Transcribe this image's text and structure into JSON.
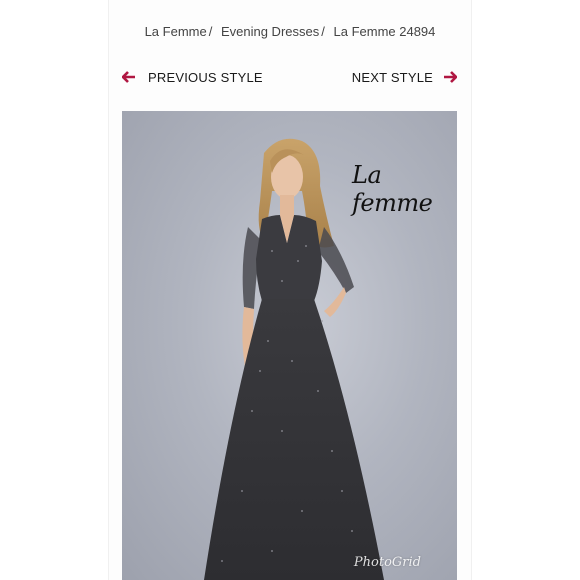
{
  "breadcrumb": {
    "items": [
      "La Femme",
      "Evening Dresses",
      "La Femme 24894"
    ]
  },
  "nav": {
    "prev_label": "PREVIOUS STYLE",
    "next_label": "NEXT STYLE",
    "arrow_color": "#b01742",
    "prev_icon": "arrow-left-icon",
    "next_icon": "arrow-right-icon"
  },
  "image": {
    "logo_text": "La femme",
    "watermark": "PhotoGrid"
  }
}
